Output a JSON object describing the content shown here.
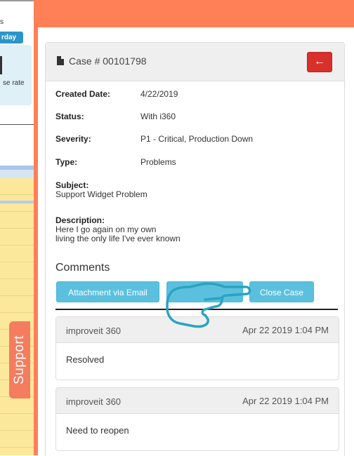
{
  "background_app": {
    "fragment_text": "s",
    "day_pill": "rday",
    "rate_fragment": "se rate",
    "support_tab": "Support"
  },
  "case": {
    "title": "Case # 00101798",
    "back_icon": "arrow-left-icon",
    "fields": {
      "created_date": {
        "label": "Created Date:",
        "value": "4/22/2019"
      },
      "status": {
        "label": "Status:",
        "value": "With i360"
      },
      "severity": {
        "label": "Severity:",
        "value": "P1 - Critical, Production Down"
      },
      "type": {
        "label": "Type:",
        "value": "Problems"
      }
    },
    "subject": {
      "label": "Subject:",
      "value": "Support Widget Problem"
    },
    "description": {
      "label": "Description:",
      "lines": [
        "Here I go again on my own",
        "living the only life I've ever known"
      ]
    }
  },
  "comments": {
    "heading": "Comments",
    "buttons": {
      "attachment": "Attachment via Email",
      "close_case": "Close Case"
    },
    "items": [
      {
        "author": "improveit 360",
        "date": "Apr 22 2019 1:04 PM",
        "body": "Resolved"
      },
      {
        "author": "improveit 360",
        "date": "Apr 22 2019 1:04 PM",
        "body": "Need to reopen"
      }
    ]
  },
  "colors": {
    "header_orange": "#ff7f56",
    "button_blue": "#5bc0de",
    "danger_red": "#d9302b",
    "pointer_teal": "#2aa3c0"
  }
}
